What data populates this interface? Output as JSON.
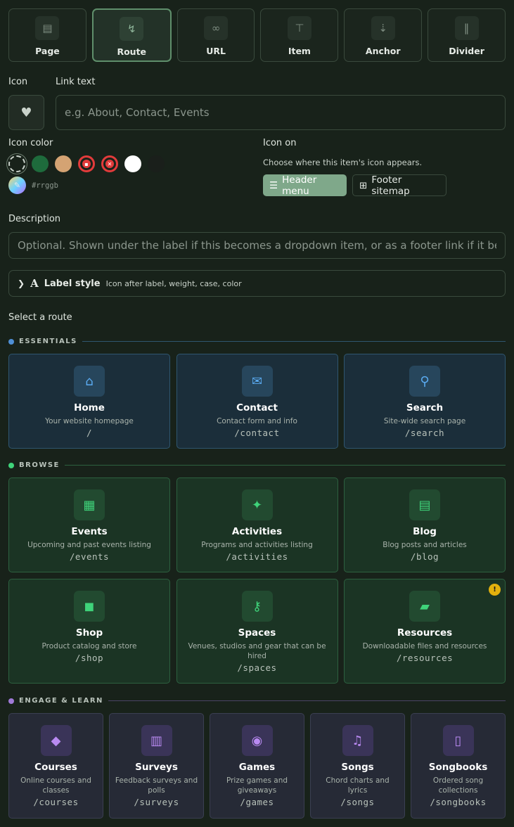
{
  "types": [
    {
      "label": "Page",
      "icon": "page-icon",
      "glyph": "▤",
      "active": false
    },
    {
      "label": "Route",
      "icon": "route-icon",
      "glyph": "↯",
      "active": true
    },
    {
      "label": "URL",
      "icon": "link-icon",
      "glyph": "∞",
      "active": false
    },
    {
      "label": "Item",
      "icon": "pin-icon",
      "glyph": "⊤",
      "active": false
    },
    {
      "label": "Anchor",
      "icon": "sort-icon",
      "glyph": "⇣",
      "active": false
    },
    {
      "label": "Divider",
      "icon": "divider-icon",
      "glyph": "‖",
      "active": false
    }
  ],
  "form": {
    "icon_label": "Icon",
    "link_text_label": "Link text",
    "link_text_placeholder": "e.g. About, Contact, Events",
    "link_text_value": "",
    "icon_color_label": "Icon color",
    "hex_placeholder": "#rrggb",
    "swatch_colors": [
      "none",
      "#1e6b3c",
      "#d4a373",
      "#e23b3b",
      "#e23b3b",
      "#ffffff",
      "#1a1f1b"
    ],
    "icon_on_label": "Icon on",
    "icon_on_help": "Choose where this item's icon appears.",
    "header_menu_label": "Header menu",
    "footer_sitemap_label": "Footer sitemap",
    "description_label": "Description",
    "description_placeholder": "Optional. Shown under the label if this becomes a dropdown item, or as a footer link if it becomes",
    "label_style_title": "Label style",
    "label_style_sub": "Icon after label, weight, case, color",
    "select_route_label": "Select a route"
  },
  "sections": {
    "essentials": {
      "title": "ESSENTIALS",
      "color": "#4f8fd6"
    },
    "browse": {
      "title": "BROWSE",
      "color": "#3fd37a"
    },
    "engage": {
      "title": "ENGAGE & LEARN",
      "color": "#a07ad8"
    }
  },
  "routes": {
    "essentials": [
      {
        "title": "Home",
        "desc": "Your website homepage",
        "path": "/",
        "icon": "home-icon",
        "glyph": "⌂"
      },
      {
        "title": "Contact",
        "desc": "Contact form and info",
        "path": "/contact",
        "icon": "envelope-icon",
        "glyph": "✉"
      },
      {
        "title": "Search",
        "desc": "Site-wide search page",
        "path": "/search",
        "icon": "search-icon",
        "glyph": "⚲"
      }
    ],
    "browse": [
      {
        "title": "Events",
        "desc": "Upcoming and past events listing",
        "path": "/events",
        "icon": "calendar-icon",
        "glyph": "▦"
      },
      {
        "title": "Activities",
        "desc": "Programs and activities listing",
        "path": "/activities",
        "icon": "running-icon",
        "glyph": "✦"
      },
      {
        "title": "Blog",
        "desc": "Blog posts and articles",
        "path": "/blog",
        "icon": "newspaper-icon",
        "glyph": "▤"
      },
      {
        "title": "Shop",
        "desc": "Product catalog and store",
        "path": "/shop",
        "icon": "shopping-bag-icon",
        "glyph": "◼"
      },
      {
        "title": "Spaces",
        "desc": "Venues, studios and gear that can be hired",
        "path": "/spaces",
        "icon": "key-icon",
        "glyph": "⚷"
      },
      {
        "title": "Resources",
        "desc": "Downloadable files and resources",
        "path": "/resources",
        "icon": "folder-icon",
        "glyph": "▰",
        "warning": true
      }
    ],
    "engage": [
      {
        "title": "Courses",
        "desc": "Online courses and classes",
        "path": "/courses",
        "icon": "graduation-cap-icon",
        "glyph": "◆"
      },
      {
        "title": "Surveys",
        "desc": "Feedback surveys and polls",
        "path": "/surveys",
        "icon": "poll-icon",
        "glyph": "▥"
      },
      {
        "title": "Games",
        "desc": "Prize games and giveaways",
        "path": "/games",
        "icon": "gamepad-icon",
        "glyph": "◉"
      },
      {
        "title": "Songs",
        "desc": "Chord charts and lyrics",
        "path": "/songs",
        "icon": "music-icon",
        "glyph": "♫"
      },
      {
        "title": "Songbooks",
        "desc": "Ordered song collections",
        "path": "/songbooks",
        "icon": "book-icon",
        "glyph": "▯"
      }
    ]
  }
}
